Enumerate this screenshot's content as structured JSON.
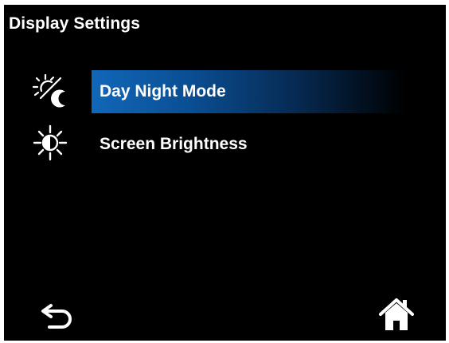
{
  "screen": {
    "title": "Display Settings"
  },
  "menu": {
    "items": [
      {
        "label": "Day Night Mode",
        "icon": "day-night-icon",
        "selected": true
      },
      {
        "label": "Screen Brightness",
        "icon": "brightness-icon",
        "selected": false
      }
    ]
  },
  "footer": {
    "back_icon": "back-arrow-icon",
    "home_icon": "home-icon"
  },
  "colors": {
    "background": "#000000",
    "text": "#ffffff",
    "selection_accent": "#1167b9"
  }
}
